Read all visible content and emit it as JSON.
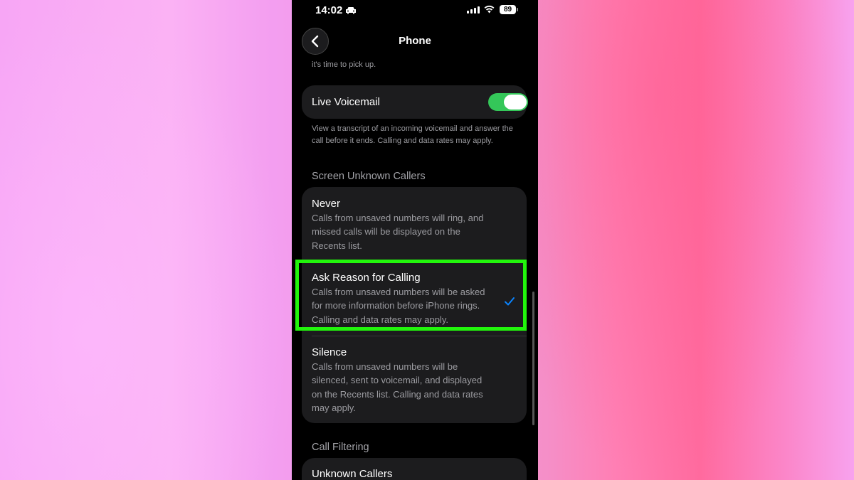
{
  "status_bar": {
    "time": "14:02",
    "battery_percent": "89"
  },
  "nav": {
    "title": "Phone"
  },
  "top_footnote": "it's time to pick up.",
  "live_voicemail": {
    "label": "Live Voicemail",
    "enabled": true,
    "footnote": "View a transcript of an incoming voicemail and answer the call before it ends. Calling and data rates may apply."
  },
  "screen_unknown_callers": {
    "header": "Screen Unknown Callers",
    "options": [
      {
        "label": "Never",
        "description": "Calls from unsaved numbers will ring, and missed calls will be displayed on the Recents list.",
        "selected": false
      },
      {
        "label": "Ask Reason for Calling",
        "description": "Calls from unsaved numbers will be asked for more information before iPhone rings. Calling and data rates may apply.",
        "selected": true
      },
      {
        "label": "Silence",
        "description": "Calls from unsaved numbers will be silenced, sent to voicemail, and displayed on the Recents list. Calling and data rates may apply.",
        "selected": false
      }
    ]
  },
  "call_filtering": {
    "header": "Call Filtering",
    "first_item": "Unknown Callers"
  },
  "colors": {
    "toggle_on": "#34c759",
    "highlight": "#22f50c",
    "checkmark": "#0a84ff",
    "card_bg": "#1c1c1e"
  }
}
